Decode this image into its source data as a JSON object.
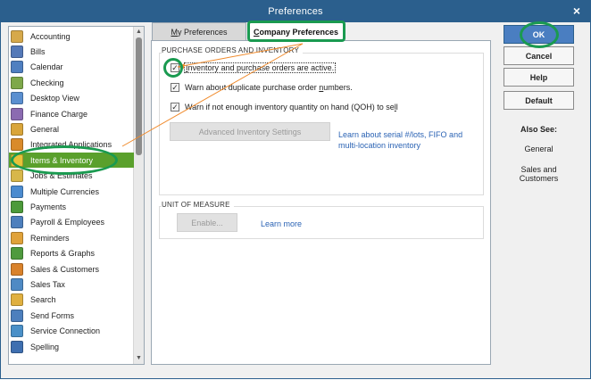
{
  "window": {
    "title": "Preferences",
    "close_glyph": "×"
  },
  "sidebar": {
    "items": [
      {
        "label": "Accounting",
        "icon": "accounting-icon",
        "color": "#d6a94b"
      },
      {
        "label": "Bills",
        "icon": "bills-icon",
        "color": "#5479b8"
      },
      {
        "label": "Calendar",
        "icon": "calendar-icon",
        "color": "#4f7fc0"
      },
      {
        "label": "Checking",
        "icon": "checking-icon",
        "color": "#7ea84a"
      },
      {
        "label": "Desktop View",
        "icon": "desktop-view-icon",
        "color": "#5a8fd0"
      },
      {
        "label": "Finance Charge",
        "icon": "finance-charge-icon",
        "color": "#8b6bb1"
      },
      {
        "label": "General",
        "icon": "general-icon",
        "color": "#d9a53a"
      },
      {
        "label": "Integrated Applications",
        "icon": "integrated-apps-icon",
        "color": "#d98b2b"
      },
      {
        "label": "Items & Inventory",
        "icon": "items-inventory-icon",
        "color": "#e6c23a"
      },
      {
        "label": "Jobs & Estimates",
        "icon": "jobs-estimates-icon",
        "color": "#d7b74a"
      },
      {
        "label": "Multiple Currencies",
        "icon": "multiple-currencies-icon",
        "color": "#4b8bcf"
      },
      {
        "label": "Payments",
        "icon": "payments-icon",
        "color": "#4c9a3a"
      },
      {
        "label": "Payroll & Employees",
        "icon": "payroll-employees-icon",
        "color": "#4d7fbd"
      },
      {
        "label": "Reminders",
        "icon": "reminders-icon",
        "color": "#e0a23a"
      },
      {
        "label": "Reports & Graphs",
        "icon": "reports-graphs-icon",
        "color": "#4f9a3e"
      },
      {
        "label": "Sales & Customers",
        "icon": "sales-customers-icon",
        "color": "#d9822b"
      },
      {
        "label": "Sales Tax",
        "icon": "sales-tax-icon",
        "color": "#4f8ac4"
      },
      {
        "label": "Search",
        "icon": "search-icon",
        "color": "#e0b040"
      },
      {
        "label": "Send Forms",
        "icon": "send-forms-icon",
        "color": "#4d7fbd"
      },
      {
        "label": "Service Connection",
        "icon": "service-connection-icon",
        "color": "#4a90c8"
      },
      {
        "label": "Spelling",
        "icon": "spelling-icon",
        "color": "#3f6fb0"
      }
    ],
    "selected_index": 8,
    "selected_color": "#5aa02c"
  },
  "tabs": {
    "my_prefix": "M",
    "my_rest": "y Preferences",
    "company_prefix": "C",
    "company_rest": "ompany Preferences"
  },
  "purchase_orders": {
    "title": "PURCHASE ORDERS AND INVENTORY",
    "checks": [
      {
        "label_pre": "",
        "label_ul": "I",
        "label_post": "nventory and purchase orders are active.",
        "checked": true
      },
      {
        "label_pre": "Warn about duplicate purchase order ",
        "label_ul": "n",
        "label_post": "umbers.",
        "checked": true
      },
      {
        "label_pre": "Warn if not enough inventory quantity on hand (QOH) to se",
        "label_ul": "l",
        "label_post": "l",
        "checked": true
      }
    ],
    "advanced_button": "Advanced Inventory Settings",
    "learn_link": "Learn about serial #/lots, FIFO and multi-location inventory"
  },
  "unit_of_measure": {
    "title": "UNIT OF MEASURE",
    "enable_button": "Enable...",
    "learn_more": "Learn more"
  },
  "buttons": {
    "ok": "OK",
    "cancel": "Cancel",
    "help": "Help",
    "default": "Default"
  },
  "also_see": {
    "heading": "Also See:",
    "links": [
      "General",
      "Sales and Customers"
    ]
  },
  "colors": {
    "titlebar": "#2b5f8d",
    "selected": "#5aa02c",
    "annotation": "#1a9a50",
    "arrow": "#f08a2b",
    "link": "#2b63b4"
  }
}
